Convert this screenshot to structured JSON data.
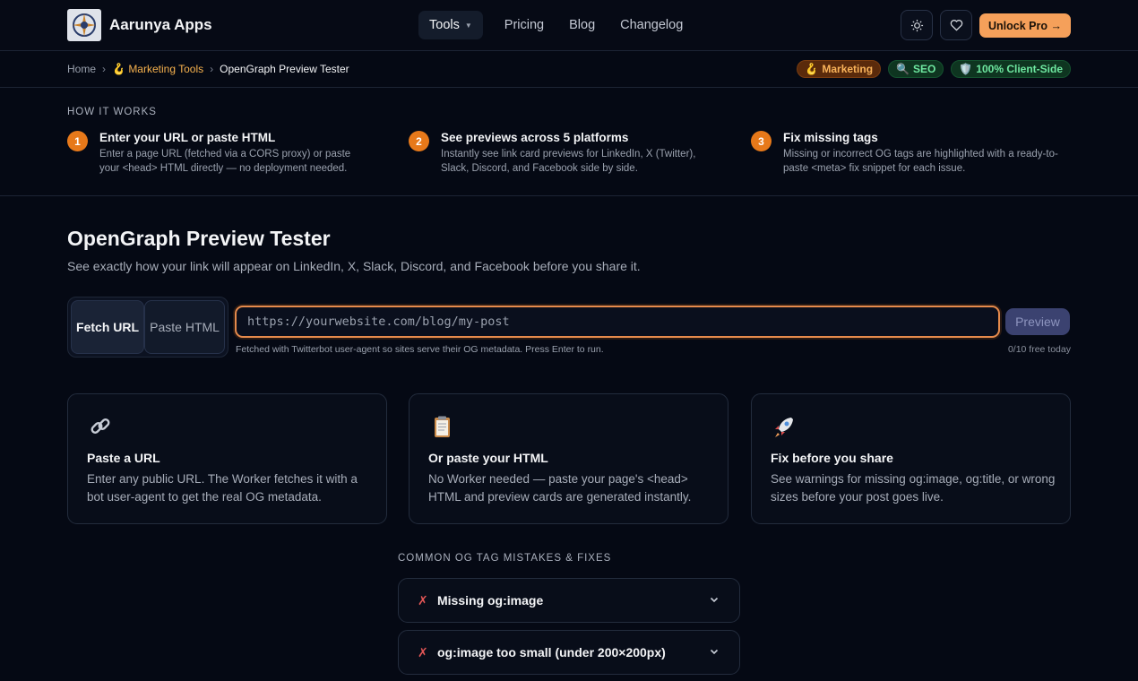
{
  "header": {
    "brand": "Aarunya Apps",
    "nav": [
      {
        "label": "Tools"
      },
      {
        "label": "Pricing"
      },
      {
        "label": "Blog"
      },
      {
        "label": "Changelog"
      }
    ],
    "unlock_label": "Unlock Pro →",
    "icons": [
      "sun-icon",
      "heart-icon"
    ]
  },
  "breadcrumb": {
    "home": "Home",
    "section": "Marketing Tools",
    "current": "OpenGraph Preview Tester",
    "section_icon": "🪝"
  },
  "badges": [
    {
      "icon": "🪝",
      "label": "Marketing"
    },
    {
      "icon": "🔍",
      "label": "SEO"
    },
    {
      "icon": "🛡️",
      "label": "100% Client-Side"
    }
  ],
  "how_it_works": {
    "title": "HOW IT WORKS",
    "steps": [
      {
        "num": "1",
        "title": "Enter your URL or paste HTML",
        "desc": "Enter a page URL (fetched via a CORS proxy) or paste your <head> HTML directly — no deployment needed."
      },
      {
        "num": "2",
        "title": "See previews across 5 platforms",
        "desc": "Instantly see link card previews for LinkedIn, X (Twitter), Slack, Discord, and Facebook side by side."
      },
      {
        "num": "3",
        "title": "Fix missing tags",
        "desc": "Missing or incorrect OG tags are highlighted with a ready-to-paste <meta> fix snippet for each issue."
      }
    ]
  },
  "main": {
    "title": "OpenGraph Preview Tester",
    "subtitle": "See exactly how your link will appear on LinkedIn, X, Slack, Discord, and Facebook before you share it.",
    "modes": {
      "fetch": "Fetch URL",
      "paste": "Paste HTML"
    },
    "url_placeholder": "https://yourwebsite.com/blog/my-post",
    "preview_label": "Preview",
    "hint": "Fetched with Twitterbot user-agent so sites serve their OG metadata. Press Enter to run.",
    "quota": "0/10 free today"
  },
  "features": [
    {
      "icon": "🔗",
      "title": "Paste a URL",
      "desc": "Enter any public URL. The Worker fetches it with a bot user-agent to get the real OG metadata."
    },
    {
      "icon": "📋",
      "title": "Or paste your HTML",
      "desc": "No Worker needed — paste your page's <head> HTML and preview cards are generated instantly."
    },
    {
      "icon": "🚀",
      "title": "Fix before you share",
      "desc": "See warnings for missing og:image, og:title, or wrong sizes before your post goes live."
    }
  ],
  "faq": {
    "title": "COMMON OG TAG MISTAKES & FIXES",
    "items": [
      {
        "mark": "✗",
        "title": "Missing og:image"
      },
      {
        "mark": "✗",
        "title": "og:image too small (under 200×200px)"
      }
    ]
  }
}
